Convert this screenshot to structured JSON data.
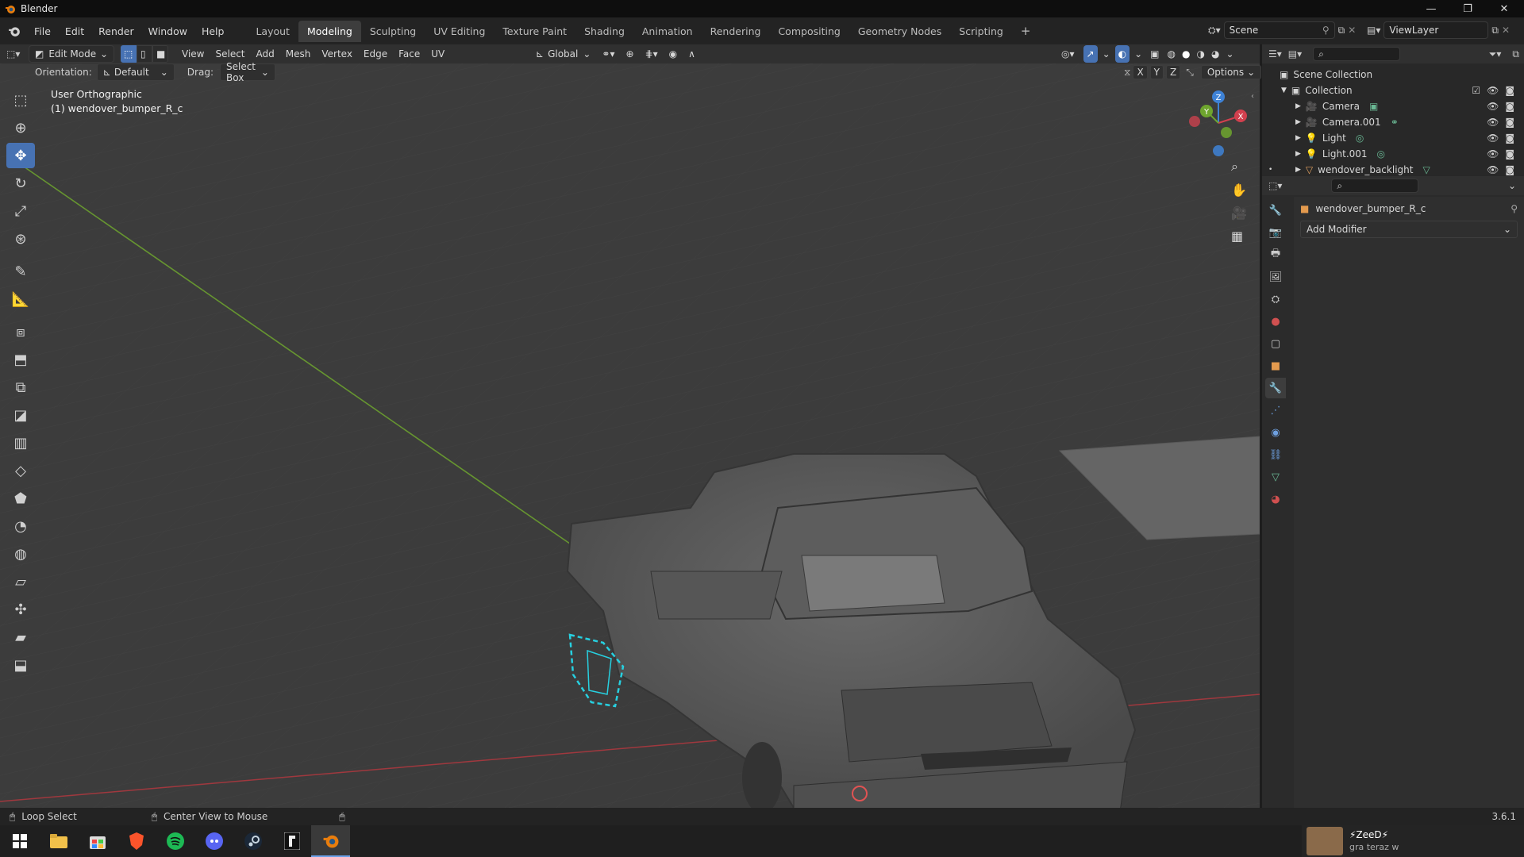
{
  "window": {
    "title": "Blender"
  },
  "menu": [
    "File",
    "Edit",
    "Render",
    "Window",
    "Help"
  ],
  "workspaces": [
    "Layout",
    "Modeling",
    "Sculpting",
    "UV Editing",
    "Texture Paint",
    "Shading",
    "Animation",
    "Rendering",
    "Compositing",
    "Geometry Nodes",
    "Scripting"
  ],
  "active_workspace": "Modeling",
  "scene": {
    "name": "Scene",
    "view_layer": "ViewLayer"
  },
  "viewport_header": {
    "mode": "Edit Mode",
    "menus": [
      "View",
      "Select",
      "Add",
      "Mesh",
      "Vertex",
      "Edge",
      "Face",
      "UV"
    ],
    "transform_orientation": "Global",
    "orientation_label": "Orientation:",
    "orientation_value": "Default",
    "drag_label": "Drag:",
    "drag_value": "Select Box",
    "axes": [
      "X",
      "Y",
      "Z"
    ],
    "options": "Options"
  },
  "viewport": {
    "view_name": "User Orthographic",
    "object_name": "(1) wendover_bumper_R_c",
    "gizmo_axes": [
      "Z",
      "Y",
      "X"
    ]
  },
  "outliner": {
    "root": "Scene Collection",
    "collection": "Collection",
    "items": [
      {
        "name": "Camera",
        "icon": "camera-icon"
      },
      {
        "name": "Camera.001",
        "icon": "camera-icon"
      },
      {
        "name": "Light",
        "icon": "light-icon"
      },
      {
        "name": "Light.001",
        "icon": "light-icon"
      },
      {
        "name": "wendover_backlight",
        "icon": "mesh-icon"
      }
    ]
  },
  "properties": {
    "object_name": "wendover_bumper_R_c",
    "add_modifier": "Add Modifier"
  },
  "statusbar": {
    "left_action": "Loop Select",
    "mid_action": "Center View to Mouse",
    "version": "3.6.1"
  },
  "taskbar": {
    "notification_name": "⚡ZeeD⚡",
    "notification_status": "gra teraz w"
  },
  "colors": {
    "accent": "#4772b3",
    "selection": "#27d0e0",
    "x_axis": "#d2404e",
    "y_axis": "#6ea52e",
    "z_axis": "#3e82d6"
  }
}
